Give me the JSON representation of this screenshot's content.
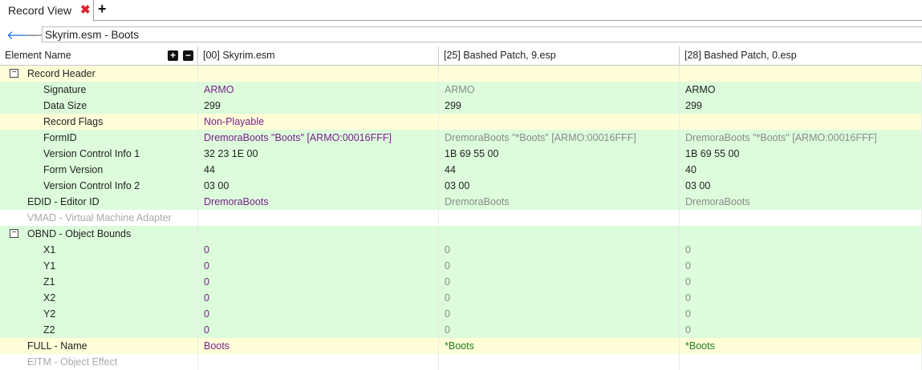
{
  "tab": {
    "label": "Record View"
  },
  "nav": {
    "path_value": "Skyrim.esm - Boots"
  },
  "columns": [
    "Element Name",
    "[00] Skyrim.esm",
    "[25] Bashed Patch, 9.esp",
    "[28] Bashed Patch, 0.esp"
  ],
  "colors": {
    "yellow_row": "#fffed9",
    "green_row": "#dcfcdc",
    "white_row": "#ffffff",
    "override_purple": "#7a1f8a",
    "match_gray": "#8a8a8a",
    "winner_green": "#1e7a1e"
  },
  "rows": [
    {
      "name": "Record Header",
      "bg": "yellow",
      "toggle": "⊟",
      "indent": 1,
      "values": [
        "",
        "",
        ""
      ]
    },
    {
      "name": "Signature",
      "bg": "green",
      "indent": 2,
      "values": [
        "ARMO",
        "ARMO",
        "ARMO"
      ],
      "styles": [
        "purple",
        "gray",
        "dark"
      ]
    },
    {
      "name": "Data Size",
      "bg": "green",
      "indent": 2,
      "values": [
        "299",
        "299",
        "299"
      ],
      "styles": [
        "dark",
        "dark",
        "dark"
      ]
    },
    {
      "name": "Record Flags",
      "bg": "yellow",
      "indent": 2,
      "values": [
        "Non-Playable",
        "",
        ""
      ],
      "styles": [
        "purple",
        "dark",
        "dark"
      ]
    },
    {
      "name": "FormID",
      "bg": "green",
      "indent": 2,
      "values": [
        "DremoraBoots \"Boots\" [ARMO:00016FFF]",
        "DremoraBoots \"*Boots\" [ARMO:00016FFF]",
        "DremoraBoots \"*Boots\" [ARMO:00016FFF]"
      ],
      "styles": [
        "purple",
        "gray",
        "gray"
      ]
    },
    {
      "name": "Version Control Info 1",
      "bg": "green",
      "indent": 2,
      "values": [
        "32 23 1E 00",
        "1B 69 55 00",
        "1B 69 55 00"
      ],
      "styles": [
        "dark",
        "dark",
        "dark"
      ]
    },
    {
      "name": "Form Version",
      "bg": "green",
      "indent": 2,
      "values": [
        "44",
        "44",
        "40"
      ],
      "styles": [
        "dark",
        "dark",
        "dark"
      ]
    },
    {
      "name": "Version Control Info 2",
      "bg": "green",
      "indent": 2,
      "values": [
        "03 00",
        "03 00",
        "03 00"
      ],
      "styles": [
        "dark",
        "dark",
        "dark"
      ]
    },
    {
      "name": "EDID - Editor ID",
      "bg": "green",
      "indent": 1,
      "values": [
        "DremoraBoots",
        "DremoraBoots",
        "DremoraBoots"
      ],
      "styles": [
        "purple",
        "gray",
        "gray"
      ]
    },
    {
      "name": "VMAD - Virtual Machine Adapter",
      "bg": "white",
      "indent": 1,
      "dim": true,
      "values": [
        "",
        "",
        ""
      ]
    },
    {
      "name": "OBND - Object Bounds",
      "bg": "green",
      "toggle": "⊟",
      "indent": 1,
      "values": [
        "",
        "",
        ""
      ]
    },
    {
      "name": "X1",
      "bg": "green",
      "indent": 2,
      "values": [
        "0",
        "0",
        "0"
      ],
      "styles": [
        "purple",
        "gray",
        "gray"
      ]
    },
    {
      "name": "Y1",
      "bg": "green",
      "indent": 2,
      "values": [
        "0",
        "0",
        "0"
      ],
      "styles": [
        "purple",
        "gray",
        "gray"
      ]
    },
    {
      "name": "Z1",
      "bg": "green",
      "indent": 2,
      "values": [
        "0",
        "0",
        "0"
      ],
      "styles": [
        "purple",
        "gray",
        "gray"
      ]
    },
    {
      "name": "X2",
      "bg": "green",
      "indent": 2,
      "values": [
        "0",
        "0",
        "0"
      ],
      "styles": [
        "purple",
        "gray",
        "gray"
      ]
    },
    {
      "name": "Y2",
      "bg": "green",
      "indent": 2,
      "values": [
        "0",
        "0",
        "0"
      ],
      "styles": [
        "purple",
        "gray",
        "gray"
      ]
    },
    {
      "name": "Z2",
      "bg": "green",
      "indent": 2,
      "values": [
        "0",
        "0",
        "0"
      ],
      "styles": [
        "purple",
        "gray",
        "gray"
      ]
    },
    {
      "name": "FULL - Name",
      "bg": "yellow",
      "indent": 1,
      "values": [
        "Boots",
        "*Boots",
        "*Boots"
      ],
      "styles": [
        "purple",
        "green",
        "green"
      ]
    },
    {
      "name": "EITM - Object Effect",
      "bg": "white",
      "indent": 1,
      "dim": true,
      "values": [
        "",
        "",
        ""
      ]
    }
  ]
}
